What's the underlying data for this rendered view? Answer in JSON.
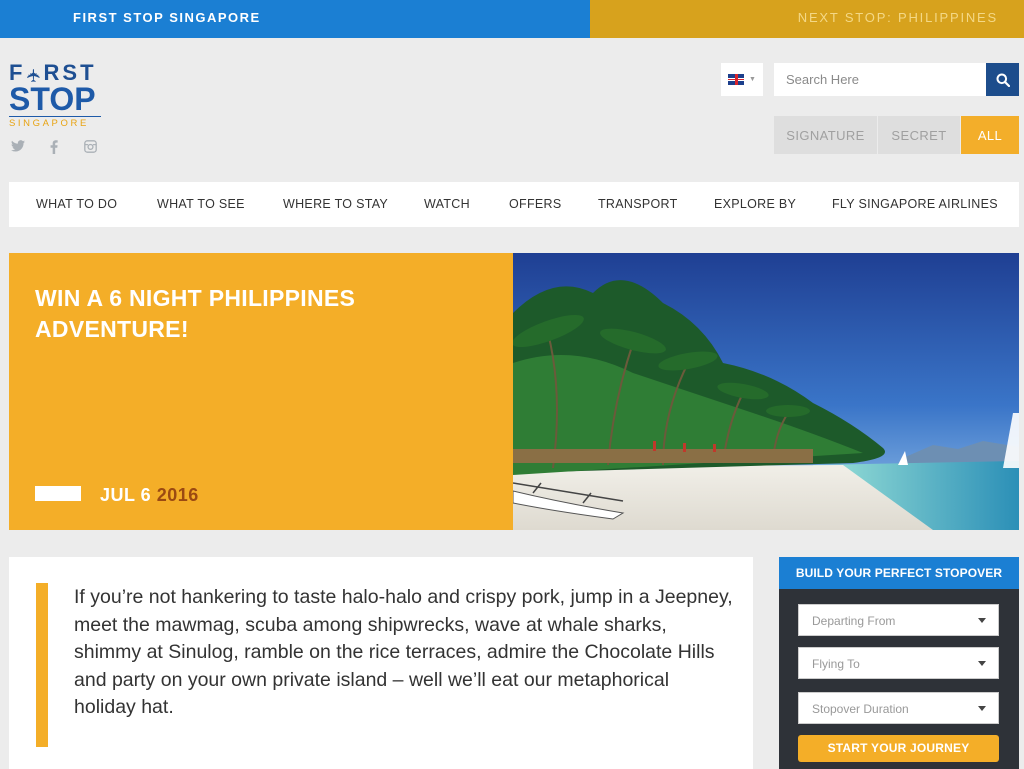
{
  "topbar": {
    "current": "FIRST STOP SINGAPORE",
    "next": "NEXT STOP: PHILIPPINES"
  },
  "logo": {
    "line1": "F✈RST",
    "line2": "STOP",
    "line3": "SINGAPORE"
  },
  "social": [
    "twitter-icon",
    "facebook-icon",
    "instagram-icon"
  ],
  "language": {
    "selected": "en-GB"
  },
  "search": {
    "placeholder": "Search Here"
  },
  "filters": [
    {
      "label": "SIGNATURE",
      "active": false
    },
    {
      "label": "SECRET",
      "active": false
    },
    {
      "label": "ALL",
      "active": true
    }
  ],
  "nav": [
    {
      "label": "WHAT TO DO"
    },
    {
      "label": "WHAT TO SEE"
    },
    {
      "label": "WHERE TO STAY"
    },
    {
      "label": "WATCH"
    },
    {
      "label": "OFFERS"
    },
    {
      "label": "TRANSPORT"
    },
    {
      "label": "EXPLORE BY"
    },
    {
      "label": "FLY SINGAPORE AIRLINES"
    }
  ],
  "hero": {
    "title": "WIN A 6 NIGHT PHILIPPINES ADVENTURE!",
    "date_day": "JUL 6",
    "date_year": "2016"
  },
  "article": {
    "quote": "If you’re not hankering to taste halo-halo and crispy pork, jump in a Jeepney, meet the mawmag, scuba among shipwrecks, wave at whale sharks, shimmy at Sinulog, ramble on the rice terraces, admire the Chocolate Hills and party on your own private island – well we’ll eat our metaphorical holiday hat."
  },
  "stopover": {
    "title": "BUILD YOUR PERFECT STOPOVER",
    "departing": "Departing From",
    "flying": "Flying To",
    "duration": "Stopover Duration",
    "button": "START YOUR JOURNEY"
  },
  "colors": {
    "blue": "#1b7fd3",
    "navy": "#1d4d8c",
    "gold": "#f4ae28",
    "dark": "#2e3238"
  }
}
